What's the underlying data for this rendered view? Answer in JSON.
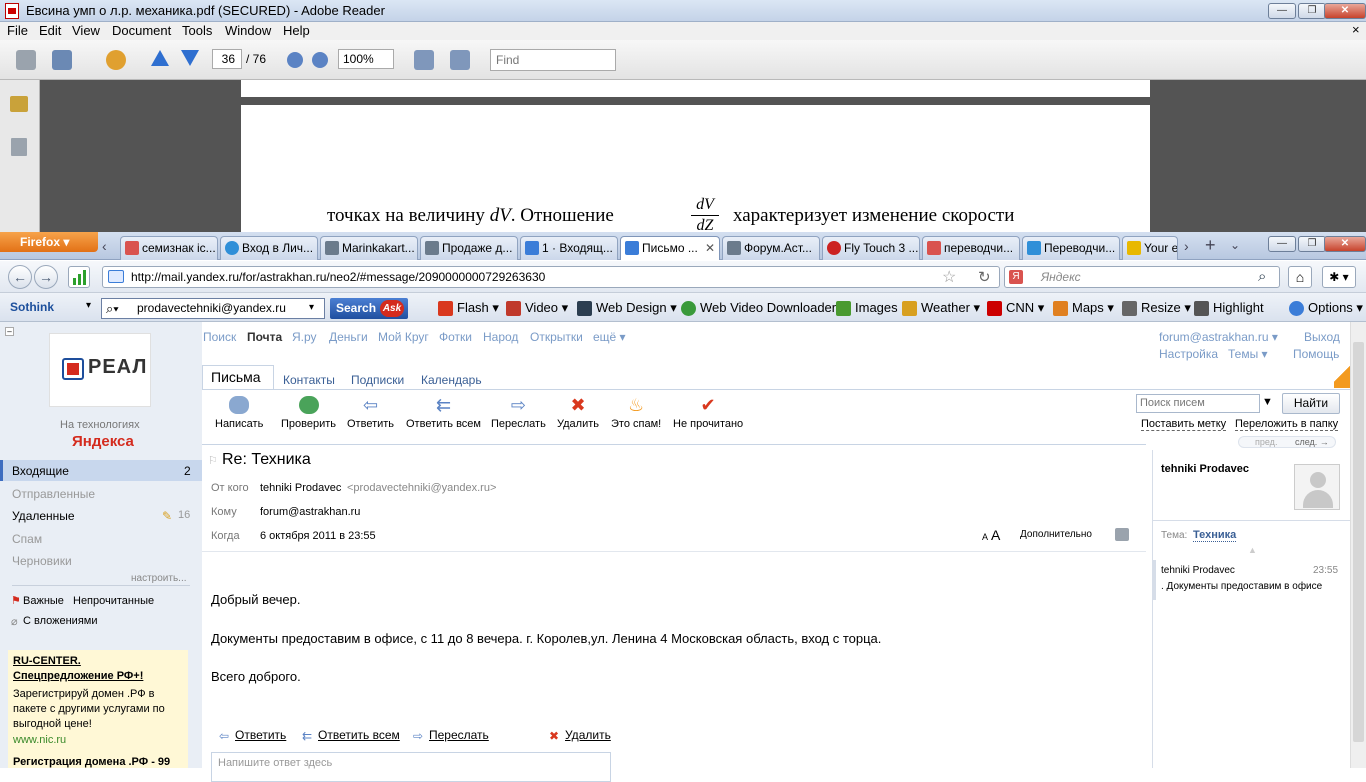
{
  "reader": {
    "title": "Евсина умп о л.р. механика.pdf (SECURED) - Adobe Reader",
    "menu": [
      "File",
      "Edit",
      "View",
      "Document",
      "Tools",
      "Window",
      "Help"
    ],
    "page_current": "36",
    "page_total": "/ 76",
    "zoom": "100%",
    "find_placeholder": "Find",
    "doc_text_1": "точках  на  величину",
    "doc_var": "dV",
    "doc_text_2": ".  Отношение",
    "frac_top": "dV",
    "frac_bottom": "dZ",
    "doc_text_3": "характеризует  изменение  скорости"
  },
  "firefox": {
    "button_label": "Firefox",
    "tabs": [
      {
        "label": "семизнак іс...",
        "color": "#d9534f"
      },
      {
        "label": "Вход в Лич...",
        "color": "#2f8fd8"
      },
      {
        "label": "Marinkakart...",
        "color": "#6b7b8c"
      },
      {
        "label": "Продаже д...",
        "color": "#6b7b8c"
      },
      {
        "label": "1 · Входящ...",
        "color": "#3b7dd8"
      },
      {
        "label": "Письмо ...",
        "color": "#3b7dd8"
      },
      {
        "label": "Форум.Аст...",
        "color": "#6b7b8c"
      },
      {
        "label": "Fly Touch 3 ...",
        "color": "#cc2222"
      },
      {
        "label": "переводчи...",
        "color": "#d9534f"
      },
      {
        "label": "Переводчи...",
        "color": "#2f8fd8"
      },
      {
        "label": "Your e",
        "color": "#e8b800"
      }
    ],
    "url": "http://mail.yandex.ru/for/astrakhan.ru/neo2/#message/2090000000729263630",
    "search_placeholder": "Яндекс",
    "sothink": "Sothink",
    "ask_value": "prodavectehniki@yandex.ru",
    "ask_button": "Search",
    "bookmarks": [
      {
        "label": "Flash",
        "color": "#d9381e"
      },
      {
        "label": "Video",
        "color": "#c0392b"
      },
      {
        "label": "Web Design",
        "color": "#2c3e50"
      },
      {
        "label": "Web Video Downloader",
        "color": "#3a9a3a"
      },
      {
        "label": "Images",
        "color": "#4a9a30"
      },
      {
        "label": "Weather",
        "color": "#d8a020"
      },
      {
        "label": "CNN",
        "color": "#cc0000"
      },
      {
        "label": "Maps",
        "color": "#e08020"
      },
      {
        "label": "Resize",
        "color": "#666666"
      },
      {
        "label": "Highlight",
        "color": "#555555"
      },
      {
        "label": "Options",
        "color": "#3b7dd8"
      }
    ]
  },
  "mail": {
    "top_nav": [
      "Поиск",
      "Почта",
      "Я.ру",
      "Деньги",
      "Мой Круг",
      "Фотки",
      "Народ",
      "Открытки",
      "ещё ▾"
    ],
    "user": "forum@astrakhan.ru ▾",
    "logout": "Выход",
    "settings": "Настройка",
    "themes": "Темы ▾",
    "help": "Помощь",
    "logo_name": "РЕАЛ",
    "tech_caption": "На технологиях",
    "yandex_word": "Яндекса",
    "folders": [
      {
        "label": "Входящие",
        "count": "2"
      },
      {
        "label": "Отправленные",
        "count": ""
      },
      {
        "label": "Удаленные",
        "count": "16"
      },
      {
        "label": "Спам",
        "count": ""
      },
      {
        "label": "Черновики",
        "count": ""
      }
    ],
    "configure": "настроить...",
    "labels": [
      "Важные",
      "Непрочитанные"
    ],
    "attachments": "С вложениями",
    "ad_title": "RU-CENTER.",
    "ad_subtitle": "Спецпредложение РФ+!",
    "ad_text_1": "Зарегистрируй домен .РФ в",
    "ad_text_2": "пакете с другими услугами по",
    "ad_text_3": "выгодной цене!",
    "ad_link": "www.nic.ru",
    "ad2": "Регистрация домена .РФ - 99",
    "tabs": [
      "Письма",
      "Контакты",
      "Подписки",
      "Календарь"
    ],
    "actions": [
      "Написать",
      "Проверить",
      "Ответить",
      "Ответить всем",
      "Переслать",
      "Удалить",
      "Это спам!",
      "Не прочитано"
    ],
    "search_placeholder": "Поиск писем",
    "find_button": "Найти",
    "set_label": "Поставить метку",
    "move_folder": "Переложить в папку",
    "prev": "пред.",
    "next": "след. →",
    "subject": "Re: Техника",
    "from_label": "От кого",
    "from_name": "tehniki Prodavec",
    "from_email": "<prodavectehniki@yandex.ru>",
    "to_label": "Кому",
    "to_value": "forum@astrakhan.ru",
    "when_label": "Когда",
    "when_value": "6 октября 2011 в 23:55",
    "font_small": "A",
    "font_big": "A",
    "more": "Дополнительно",
    "body": [
      "Добрый вечер.",
      "Документы предоставим в офисе, с 11 до 8 вечера. г. Королев,ул. Ленина 4 Московская область, вход с торца.",
      "Всего доброго."
    ],
    "reply_actions": [
      "Ответить",
      "Ответить всем",
      "Переслать",
      "Удалить"
    ],
    "reply_placeholder": "Напишите ответ здесь",
    "contact_name": "tehniki Prodavec",
    "topic_label": "Тема:",
    "topic_value": "Техника",
    "thread_from": "tehniki Prodavec",
    "thread_time": "23:55",
    "thread_snippet": ". Документы предоставим в офисе"
  }
}
